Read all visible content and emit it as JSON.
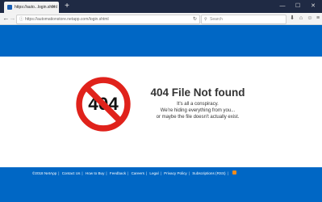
{
  "browser": {
    "tab_title": "https://auto...login.shtml",
    "url": "https://automationstore.netapp.com/login.shtml",
    "search_placeholder": "Search"
  },
  "error": {
    "badge_text": "404",
    "title": "404 File Not found",
    "lines": [
      "It's all a conspiracy.",
      "We're hiding everything from you...",
      "or maybe the file doesn't actually exist."
    ]
  },
  "footer": {
    "copyright": "©2018 NetApp",
    "links": [
      "Contact Us",
      "How to Buy",
      "Feedback",
      "Careers",
      "Legal",
      "Privacy Policy",
      "Subscriptions (RSS)"
    ]
  },
  "colors": {
    "brand_blue": "#0067c5",
    "prohibition_red": "#e0221b"
  },
  "icons": {
    "rss": "rss-icon",
    "prohibition": "prohibition-icon"
  }
}
